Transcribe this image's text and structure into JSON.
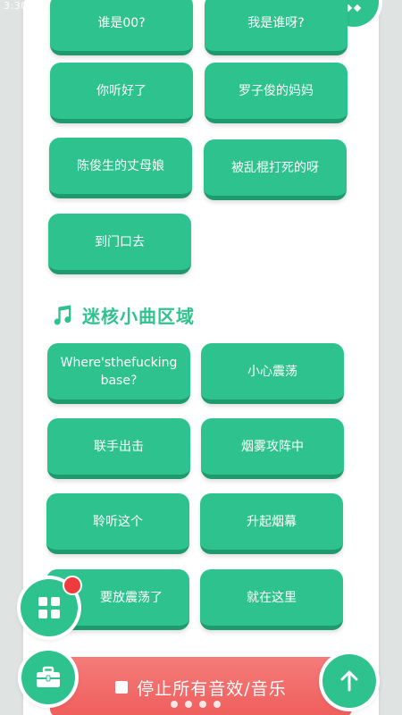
{
  "status_bar": {
    "time": "3:30"
  },
  "sound_buttons": [
    {
      "label": "谁是00?"
    },
    {
      "label": "我是谁呀?"
    },
    {
      "label": "你听好了"
    },
    {
      "label": "罗子俊的妈妈"
    },
    {
      "label": "陈俊生的丈母娘"
    },
    {
      "label": "被乱棍打死的呀"
    },
    {
      "label": "到门口去"
    }
  ],
  "section": {
    "title": "迷核小曲区域",
    "icon": "music-note-icon"
  },
  "section_buttons": [
    {
      "label": "Where'sthefucking base?"
    },
    {
      "label": "小心震荡"
    },
    {
      "label": "联手出击"
    },
    {
      "label": "烟雾攻阵中"
    },
    {
      "label": "聆听这个"
    },
    {
      "label": "升起烟幕"
    },
    {
      "label": "要放震荡了"
    },
    {
      "label": "就在这里"
    }
  ],
  "stop_all": {
    "label": "停止所有音效/音乐"
  },
  "icons": {
    "menu": "grid-icon",
    "toolbox": "toolbox-icon",
    "scroll_top": "arrow-up-icon",
    "corner": "music-share-icon"
  },
  "colors": {
    "accent": "#2ec38e",
    "accent_dark": "#1f9a6e",
    "stop": "#ef5e5c",
    "badge": "#ef3b3b"
  }
}
